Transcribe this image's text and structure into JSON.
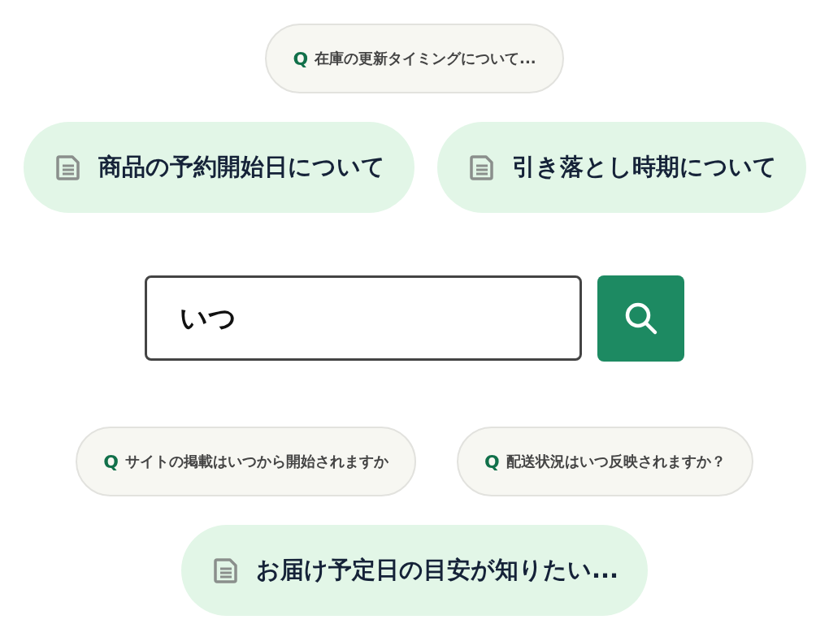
{
  "upper_rows": [
    {
      "items": [
        {
          "kind": "question",
          "mark": "Q",
          "label": "在庫の更新タイミングについて..."
        }
      ]
    },
    {
      "items": [
        {
          "kind": "article",
          "label": "商品の予約開始日について"
        },
        {
          "kind": "article",
          "label": "引き落とし時期について"
        }
      ]
    }
  ],
  "search": {
    "value": "いつ"
  },
  "lower_rows": [
    {
      "items": [
        {
          "kind": "question",
          "mark": "Q",
          "label": "サイトの掲載はいつから開始されますか"
        },
        {
          "kind": "question",
          "mark": "Q",
          "label": "配送状況はいつ反映されますか？"
        }
      ]
    },
    {
      "items": [
        {
          "kind": "article",
          "label": "お届け予定日の目安が知りたい..."
        }
      ]
    }
  ]
}
